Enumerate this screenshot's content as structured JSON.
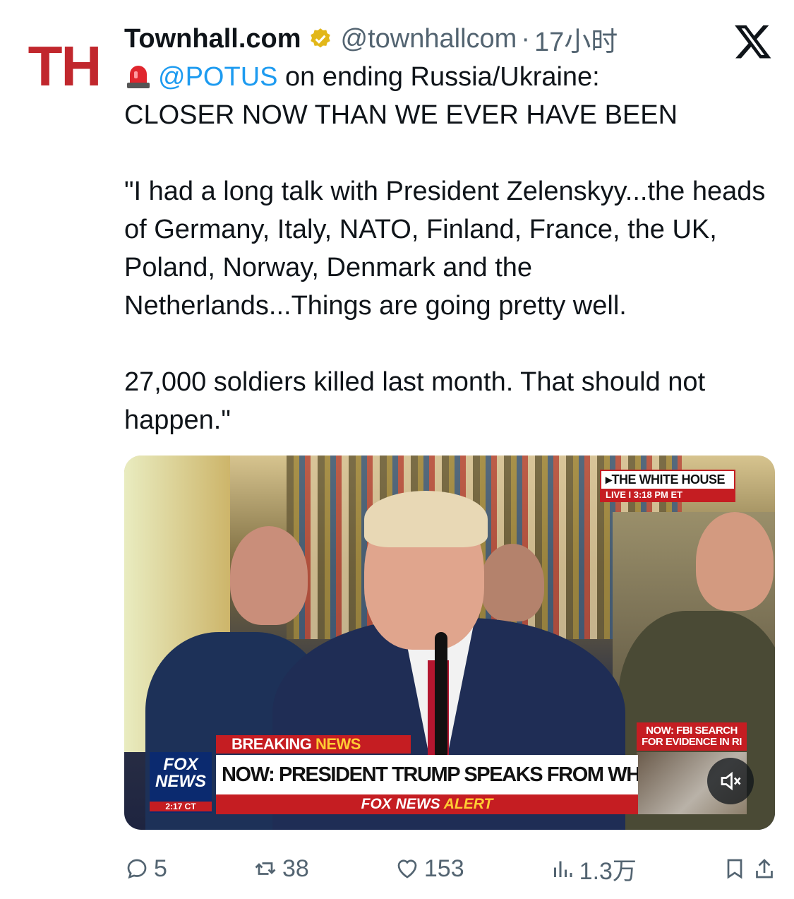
{
  "avatar": {
    "text": "TH",
    "color": "#c1272d"
  },
  "author": {
    "name": "Townhall.com",
    "handle": "@townhallcom",
    "separator": "·",
    "time": "17小时",
    "verified_color": "#e2b719"
  },
  "tweet": {
    "mention": "@POTUS",
    "line1_rest": " on ending Russia/Ukraine:",
    "body": "CLOSER NOW THAN WE EVER HAVE BEEN\n\n\"I had a long talk with President Zelenskyy...the heads of Germany, Italy, NATO, Finland, France, the UK, Poland, Norway, Denmark and the Netherlands...Things are going pretty well.\n\n27,000 soldiers killed last month. That should not happen.\""
  },
  "video": {
    "location_label": "▸THE WHITE HOUSE",
    "live_label": "LIVE  I  3:18 PM ET",
    "breaking": "BREAKING",
    "breaking_news": "NEWS",
    "headline": "NOW: PRESIDENT TRUMP SPEAKS FROM WHITE HOUSE",
    "alert_prefix": "FOX NEWS",
    "alert_word": "ALERT",
    "side_label": "NOW: FBI SEARCH FOR EVIDENCE IN RI",
    "logo_line1": "FOX",
    "logo_line2": "NEWS",
    "logo_time": "2:17 CT",
    "mute_icon": "volume-muted-icon"
  },
  "actions": {
    "replies": "5",
    "reposts": "38",
    "likes": "153",
    "views": "1.3万"
  },
  "colors": {
    "link": "#1d9bf0",
    "secondary_text": "#536471",
    "fox_red": "#c51d22",
    "fox_blue": "#0b2a6f"
  }
}
